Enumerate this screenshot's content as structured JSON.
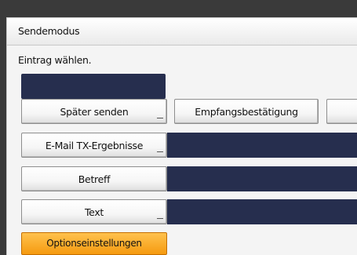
{
  "window": {
    "title": "Sendemodus",
    "instruction": "Eintrag wählen."
  },
  "buttons": {
    "send_later": "Später senden",
    "receipt_confirmation": "Empfangsbestätigung",
    "email_tx_results": "E-Mail TX-Ergebnisse",
    "subject": "Betreff",
    "text": "Text",
    "option_settings": "Optionseinstellungen"
  },
  "colors": {
    "value_field": "#262e4e",
    "option_button": "#f7a81b"
  }
}
